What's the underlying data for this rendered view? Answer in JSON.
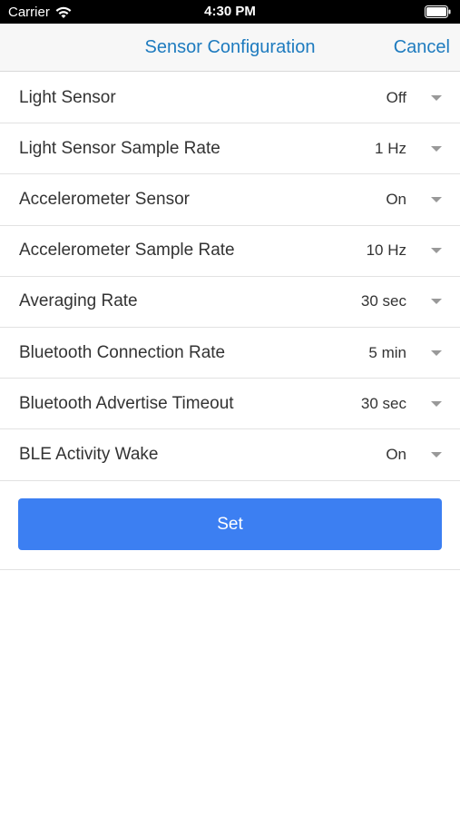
{
  "status_bar": {
    "carrier": "Carrier",
    "time": "4:30 PM"
  },
  "nav": {
    "title": "Sensor Configuration",
    "cancel_label": "Cancel"
  },
  "settings": [
    {
      "label": "Light Sensor",
      "value": "Off"
    },
    {
      "label": "Light Sensor Sample Rate",
      "value": "1 Hz"
    },
    {
      "label": "Accelerometer Sensor",
      "value": "On"
    },
    {
      "label": "Accelerometer Sample Rate",
      "value": "10 Hz"
    },
    {
      "label": "Averaging Rate",
      "value": "30 sec"
    },
    {
      "label": "Bluetooth Connection Rate",
      "value": "5 min"
    },
    {
      "label": "Bluetooth Advertise Timeout",
      "value": "30 sec"
    },
    {
      "label": "BLE Activity Wake",
      "value": "On"
    }
  ],
  "actions": {
    "set_label": "Set"
  },
  "colors": {
    "accent": "#1e7bbf",
    "button": "#3c7ff2"
  }
}
